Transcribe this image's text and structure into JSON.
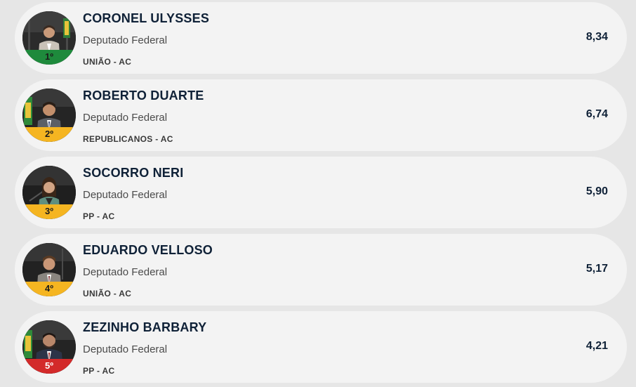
{
  "ranking": [
    {
      "position": "1º",
      "name": "CORONEL ULYSSES",
      "role": "Deputado Federal",
      "party": "UNIÃO - AC",
      "score": "8,34",
      "band_color": "#1e8a3c"
    },
    {
      "position": "2º",
      "name": "ROBERTO DUARTE",
      "role": "Deputado Federal",
      "party": "REPUBLICANOS - AC",
      "score": "6,74",
      "band_color": "#f5b521"
    },
    {
      "position": "3º",
      "name": "SOCORRO NERI",
      "role": "Deputado Federal",
      "party": "PP - AC",
      "score": "5,90",
      "band_color": "#f5b521"
    },
    {
      "position": "4º",
      "name": "EDUARDO VELLOSO",
      "role": "Deputado Federal",
      "party": "UNIÃO - AC",
      "score": "5,17",
      "band_color": "#f5b521"
    },
    {
      "position": "5º",
      "name": "ZEZINHO BARBARY",
      "role": "Deputado Federal",
      "party": "PP - AC",
      "score": "4,21",
      "band_color": "#d32a2a"
    }
  ]
}
